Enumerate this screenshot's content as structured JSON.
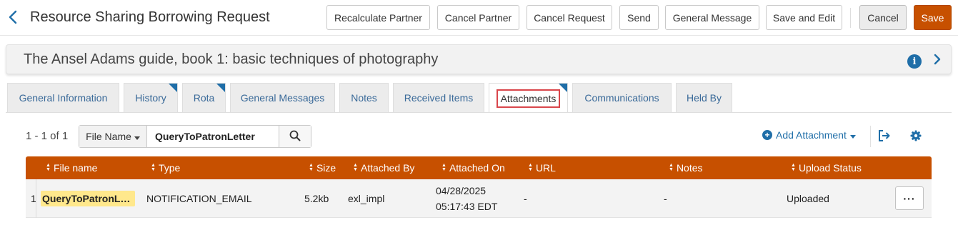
{
  "header": {
    "title": "Resource Sharing Borrowing Request",
    "buttons": {
      "recalculate_partner": "Recalculate Partner",
      "cancel_partner": "Cancel Partner",
      "cancel_request": "Cancel Request",
      "send": "Send",
      "general_message": "General Message",
      "save_and_edit": "Save and Edit",
      "cancel": "Cancel",
      "save": "Save"
    }
  },
  "record": {
    "title": "The Ansel Adams guide, book 1: basic techniques of photography"
  },
  "tabs": [
    {
      "label": "General Information"
    },
    {
      "label": "History"
    },
    {
      "label": "Rota"
    },
    {
      "label": "General Messages"
    },
    {
      "label": "Notes"
    },
    {
      "label": "Received Items"
    },
    {
      "label": "Attachments"
    },
    {
      "label": "Communications"
    },
    {
      "label": "Held By"
    }
  ],
  "toolbar": {
    "count": "1 - 1 of 1",
    "search_field": "File Name",
    "search_value": "QueryToPatronLetter",
    "add_attachment": "Add Attachment"
  },
  "table": {
    "columns": [
      "File name",
      "Type",
      "Size",
      "Attached By",
      "Attached On",
      "URL",
      "Notes",
      "Upload Status"
    ],
    "rows": [
      {
        "num": "1",
        "file_name": "QueryToPatronLetter",
        "type": "NOTIFICATION_EMAIL",
        "size": "5.2kb",
        "attached_by": "exl_impl",
        "attached_on_date": "04/28/2025",
        "attached_on_time": "05:17:43 EDT",
        "url": "-",
        "notes": "-",
        "upload_status": "Uploaded",
        "actions": "···"
      }
    ]
  },
  "colors": {
    "accent": "#c75000",
    "link": "#1f6ea8",
    "highlight": "#ffe88c",
    "active_tab_outline": "#d9464b"
  }
}
